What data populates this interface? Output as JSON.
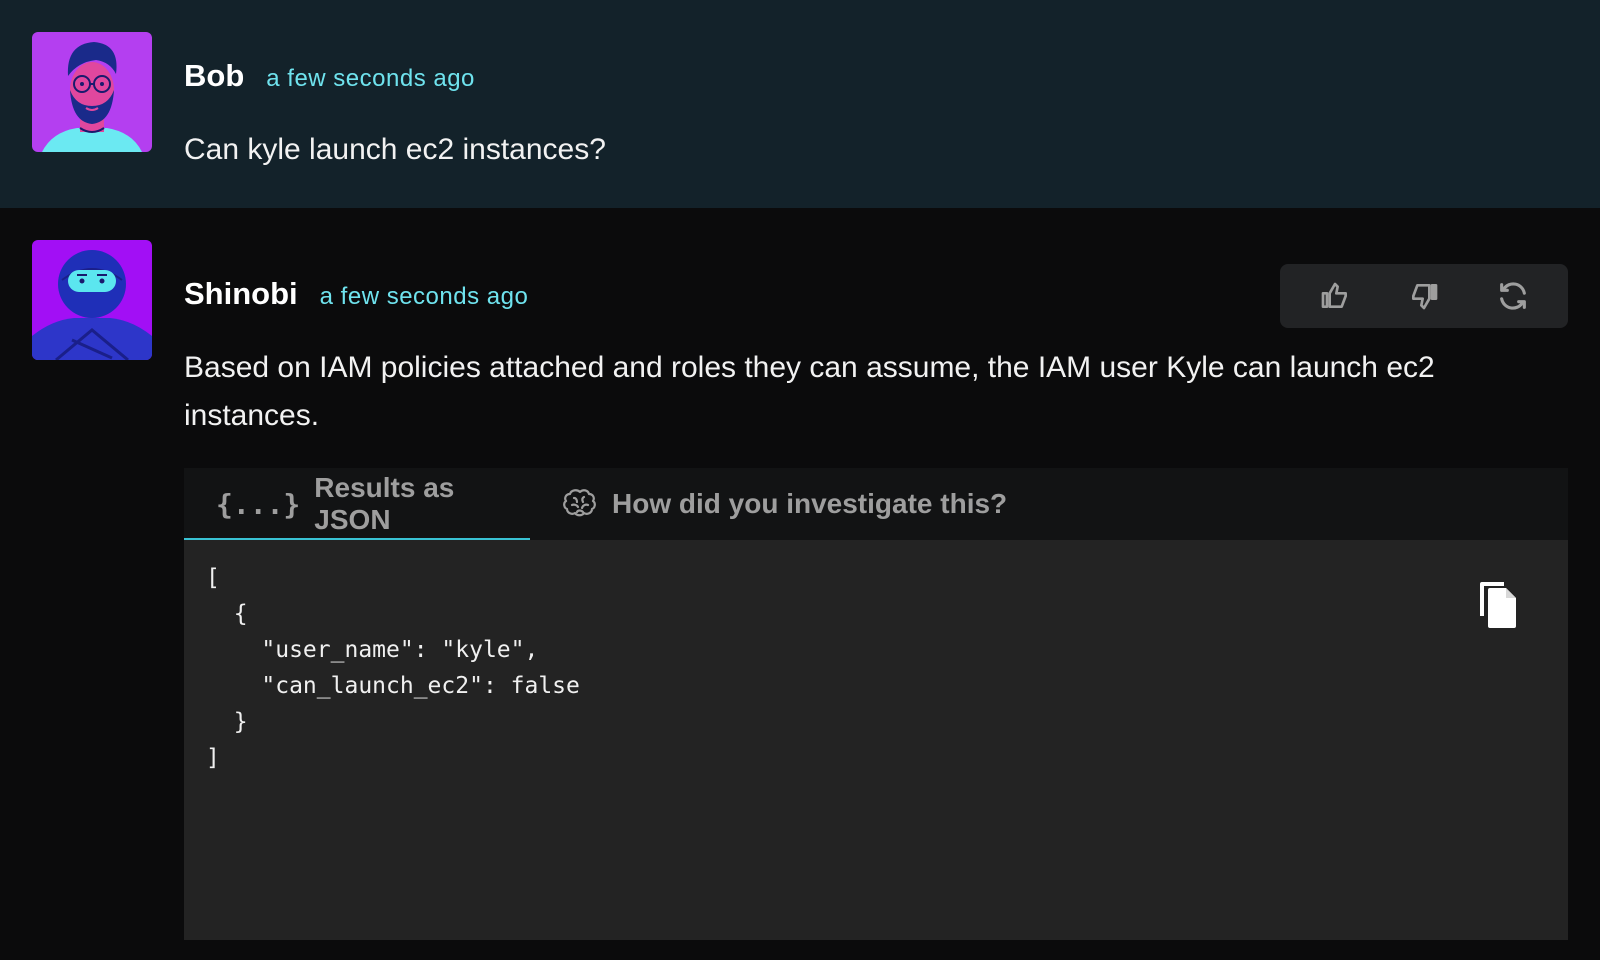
{
  "user_message": {
    "author": "Bob",
    "time": "a few seconds ago",
    "text": "Can kyle launch ec2 instances?",
    "avatar": "bearded-man-avatar"
  },
  "bot_message": {
    "author": "Shinobi",
    "time": "a few seconds ago",
    "text": "Based on IAM policies attached and roles they can assume, the IAM user Kyle can launch ec2 instances.",
    "avatar": "ninja-avatar",
    "feedback_icons": [
      "thumbs-up-icon",
      "thumbs-down-icon",
      "refresh-icon"
    ],
    "tabs": [
      {
        "label": "Results as JSON",
        "icon": "{...}",
        "active": true
      },
      {
        "label": "How did you investigate this?",
        "icon": "brain-icon",
        "active": false
      }
    ],
    "code": "[\n  {\n    \"user_name\": \"kyle\",\n    \"can_launch_ec2\": false\n  }\n]"
  },
  "colors": {
    "user_bg": "#13222a",
    "bot_bg": "#0b0b0c",
    "timestamp": "#6fe3ee",
    "tab_underline": "#39c3d4",
    "panel_bg": "#232323"
  }
}
